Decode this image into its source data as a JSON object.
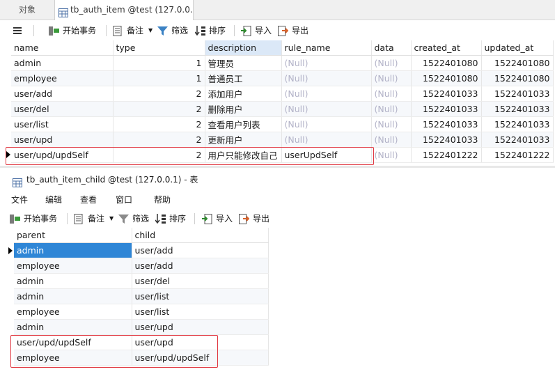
{
  "tabs": {
    "objects": "对象",
    "active": "tb_auth_item @test (127.0.0...."
  },
  "toolbar1": {
    "begin_tx": "开始事务",
    "note": "备注",
    "filter": "筛选",
    "sort": "排序",
    "import": "导入",
    "export": "导出"
  },
  "grid1": {
    "columns": [
      "name",
      "type",
      "description",
      "rule_name",
      "data",
      "created_at",
      "updated_at"
    ],
    "rows": [
      [
        "admin",
        "1",
        "管理员",
        "(Null)",
        "(Null)",
        "1522401080",
        "1522401080"
      ],
      [
        "employee",
        "1",
        "普通员工",
        "(Null)",
        "(Null)",
        "1522401080",
        "1522401080"
      ],
      [
        "user/add",
        "2",
        "添加用户",
        "(Null)",
        "(Null)",
        "1522401033",
        "1522401033"
      ],
      [
        "user/del",
        "2",
        "删除用户",
        "(Null)",
        "(Null)",
        "1522401033",
        "1522401033"
      ],
      [
        "user/list",
        "2",
        "查看用户列表",
        "(Null)",
        "(Null)",
        "1522401033",
        "1522401033"
      ],
      [
        "user/upd",
        "2",
        "更新用户",
        "(Null)",
        "(Null)",
        "1522401033",
        "1522401033"
      ],
      [
        "user/upd/updSelf",
        "2",
        "用户只能修改自己",
        "userUpdSelf",
        "(Null)",
        "1522401222",
        "1522401222"
      ]
    ]
  },
  "window2": {
    "title": "tb_auth_item_child @test (127.0.0.1) - 表",
    "menu": [
      "文件",
      "编辑",
      "查看",
      "窗口",
      "帮助"
    ],
    "toolbar": {
      "begin_tx": "开始事务",
      "note": "备注",
      "filter": "筛选",
      "sort": "排序",
      "import": "导入",
      "export": "导出"
    }
  },
  "grid2": {
    "columns": [
      "parent",
      "child"
    ],
    "rows": [
      [
        "admin",
        "user/add"
      ],
      [
        "employee",
        "user/add"
      ],
      [
        "admin",
        "user/del"
      ],
      [
        "admin",
        "user/list"
      ],
      [
        "employee",
        "user/list"
      ],
      [
        "admin",
        "user/upd"
      ],
      [
        "user/upd/updSelf",
        "user/upd"
      ],
      [
        "employee",
        "user/upd/updSelf"
      ]
    ]
  },
  "colors": {
    "selection": "#2f86d6",
    "highlight_box": "#e0353f",
    "null_text": "#b3b3c8"
  }
}
